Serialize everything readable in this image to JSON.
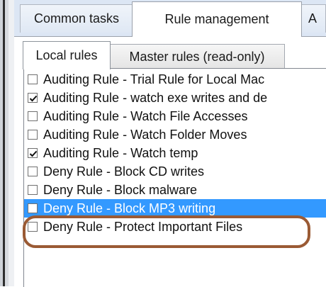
{
  "tabs": {
    "common_tasks": "Common tasks",
    "rule_management": "Rule management",
    "partial_next": "A"
  },
  "subtabs": {
    "local_rules": "Local rules",
    "master_rules": "Master rules (read-only)"
  },
  "rules": [
    {
      "label": "Auditing Rule - Trial Rule for Local Mac",
      "checked": false
    },
    {
      "label": "Auditing Rule - watch exe writes and de",
      "checked": true
    },
    {
      "label": "Auditing Rule - Watch File Accesses",
      "checked": false
    },
    {
      "label": "Auditing Rule - Watch Folder Moves",
      "checked": false
    },
    {
      "label": "Auditing Rule - Watch temp",
      "checked": true
    },
    {
      "label": "Deny Rule - Block CD writes",
      "checked": false
    },
    {
      "label": "Deny Rule - Block malware",
      "checked": false
    },
    {
      "label": "Deny Rule - Block MP3 writing",
      "checked": false,
      "selected": true
    },
    {
      "label": "Deny Rule - Protect Important Files",
      "checked": false
    }
  ],
  "colors": {
    "selection": "#3399ff",
    "annotation_ring": "#9a5a34"
  }
}
